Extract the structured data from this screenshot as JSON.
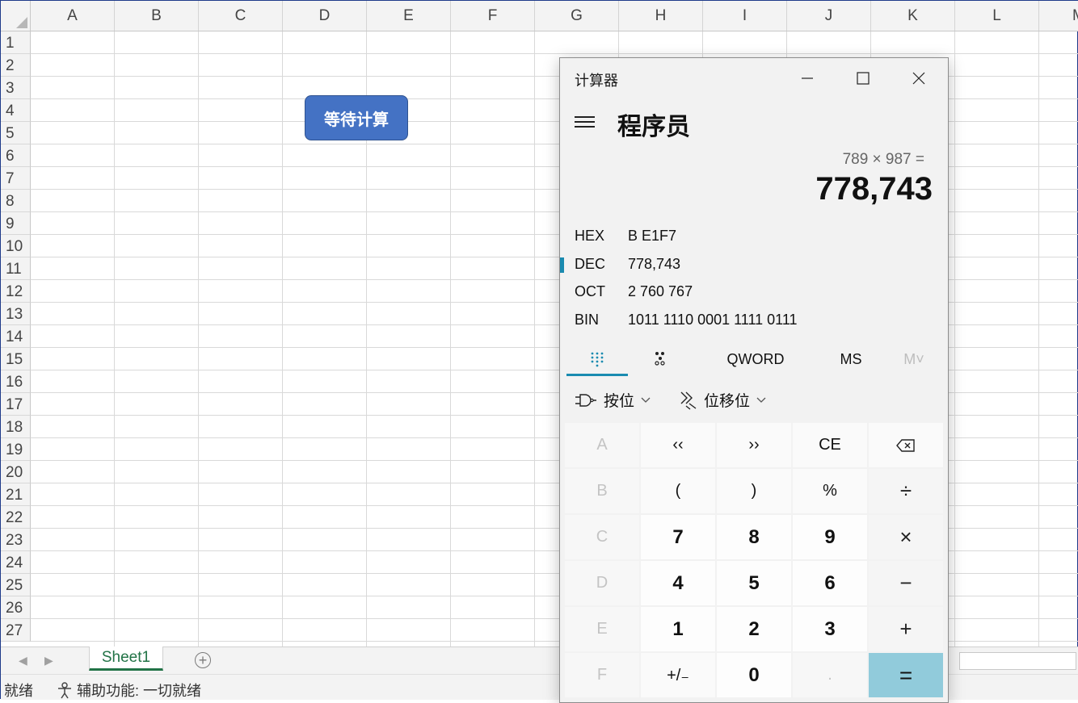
{
  "sheet": {
    "columns": [
      "A",
      "B",
      "C",
      "D",
      "E",
      "F",
      "G",
      "H",
      "I",
      "J",
      "K",
      "L",
      "M"
    ],
    "rows": [
      "1",
      "2",
      "3",
      "4",
      "5",
      "6",
      "7",
      "8",
      "9",
      "10",
      "11",
      "12",
      "13",
      "14",
      "15",
      "16",
      "17",
      "18",
      "19",
      "20",
      "21",
      "22",
      "23",
      "24",
      "25",
      "26",
      "27"
    ],
    "shape_button": "等待计算",
    "tab": "Sheet1",
    "status_ready": "就绪",
    "accessibility": "辅助功能: 一切就绪"
  },
  "calc": {
    "window_title": "计算器",
    "mode": "程序员",
    "expression": "789 × 987 =",
    "result": "778,743",
    "radix": [
      {
        "label": "HEX",
        "value": "B E1F7",
        "active": false
      },
      {
        "label": "DEC",
        "value": "778,743",
        "active": true
      },
      {
        "label": "OCT",
        "value": "2 760 767",
        "active": false
      },
      {
        "label": "BIN",
        "value": "1011 1110 0001 1111 0111",
        "active": false
      }
    ],
    "tabs": {
      "word": "QWORD",
      "ms": "MS",
      "mlist": "M˅"
    },
    "bitwise_label": "按位",
    "shift_label": "位移位",
    "keys": [
      [
        "A",
        "‹‹",
        "››",
        "CE",
        "⌫"
      ],
      [
        "B",
        "(",
        ")",
        "%",
        "÷"
      ],
      [
        "C",
        "7",
        "8",
        "9",
        "×"
      ],
      [
        "D",
        "4",
        "5",
        "6",
        "−"
      ],
      [
        "E",
        "1",
        "2",
        "3",
        "+"
      ],
      [
        "F",
        "+/₋",
        "0",
        ".",
        "="
      ]
    ],
    "accent_color": "#1a8bb0",
    "equals_color": "#91cbdb"
  }
}
